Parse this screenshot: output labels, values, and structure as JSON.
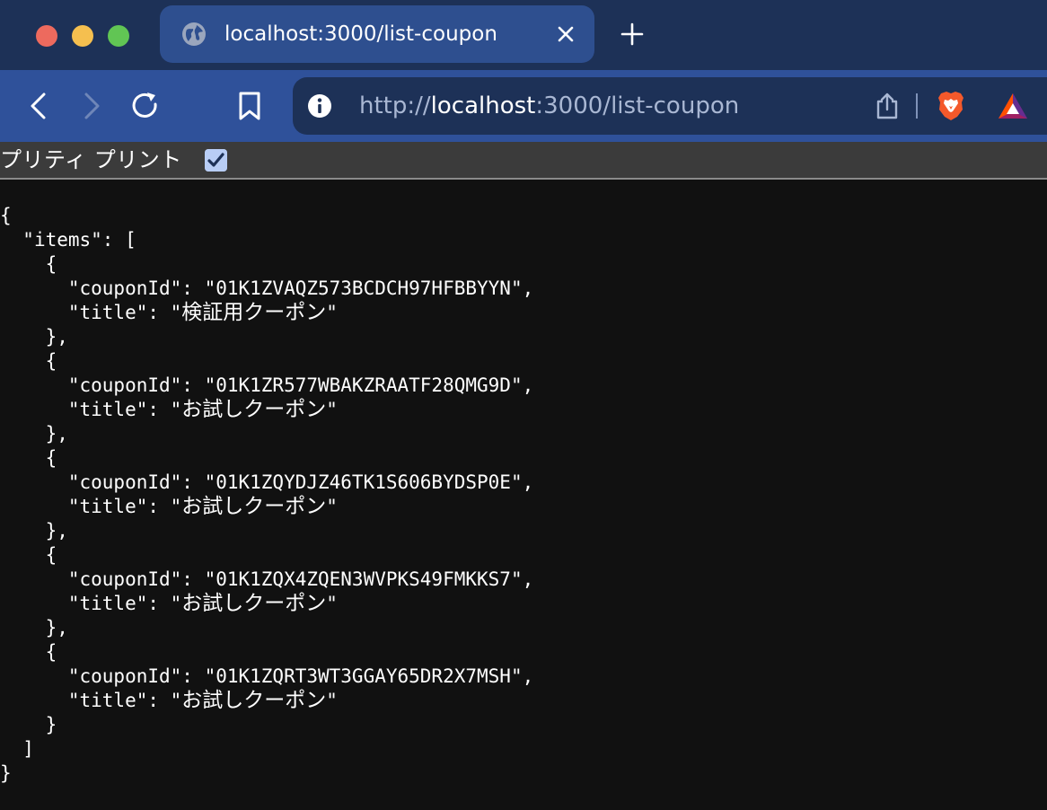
{
  "window": {
    "tab_title": "localhost:3000/list-coupon",
    "new_tab_label": "+"
  },
  "toolbar": {
    "url_scheme": "http://",
    "url_host": "localhost",
    "url_rest": ":3000/list-coupon"
  },
  "pretty_print": {
    "label": "プリティ プリント",
    "checked": true
  },
  "json": {
    "root_key": "items",
    "items": [
      {
        "couponId": "01K1ZVAQZ573BCDCH97HFBBYYN",
        "title": "検証用クーポン"
      },
      {
        "couponId": "01K1ZR577WBAKZRAATF28QMG9D",
        "title": "お試しクーポン"
      },
      {
        "couponId": "01K1ZQYDJZ46TK1S606BYDSP0E",
        "title": "お試しクーポン"
      },
      {
        "couponId": "01K1ZQX4ZQEN3WVPKS49FMKKS7",
        "title": "お試しクーポン"
      },
      {
        "couponId": "01K1ZQRT3WT3GGAY65DR2X7MSH",
        "title": "お試しクーポン"
      }
    ]
  },
  "colors": {
    "tabbar_bg": "#1d3157",
    "toolbar_bg": "#2f519a",
    "page_bg": "#111111"
  }
}
